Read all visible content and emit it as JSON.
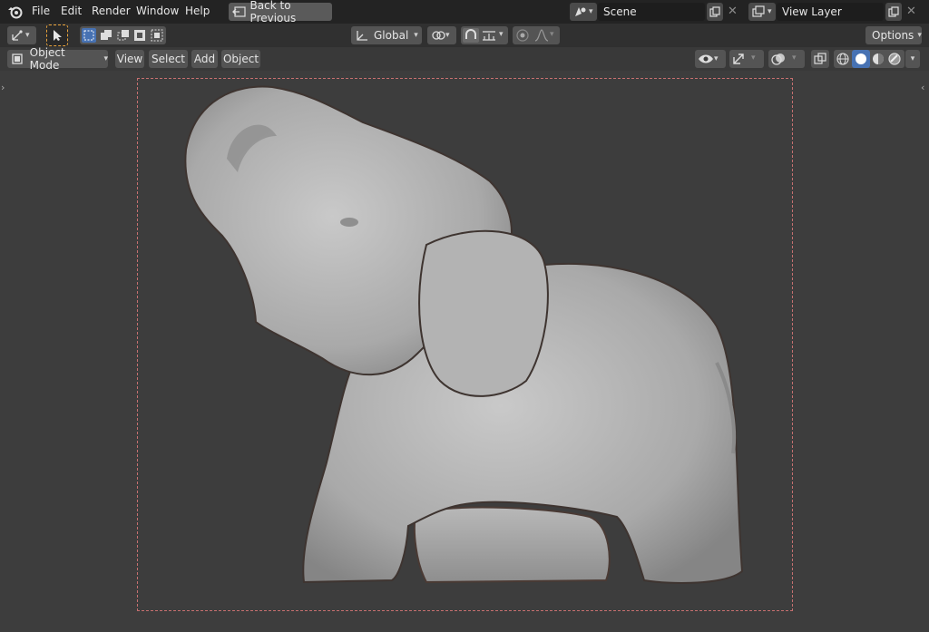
{
  "topbar": {
    "menus": [
      "File",
      "Edit",
      "Render",
      "Window",
      "Help"
    ],
    "back_button": "Back to Previous",
    "scene": {
      "label": "Scene"
    },
    "view_layer": {
      "label": "View Layer"
    }
  },
  "toolbar": {
    "orientation": "Global",
    "options_label": "Options"
  },
  "header": {
    "mode": "Object Mode",
    "menus": [
      "View",
      "Select",
      "Add",
      "Object"
    ]
  },
  "colors": {
    "accent_orange": "#e8a33c",
    "active_blue": "#4772b3",
    "camera_frame": "#c77070"
  },
  "icons": [
    "blender-logo-icon",
    "back-icon",
    "scene-icon",
    "view-layer-icon",
    "new-icon",
    "close-icon",
    "transform-pivot-icon",
    "select-cursor-icon",
    "snap-icon",
    "proportional-edit-icon",
    "visibility-icon",
    "gizmo-icon",
    "overlay-icon",
    "xray-icon",
    "wireframe-shading-icon",
    "solid-shading-icon",
    "material-shading-icon",
    "rendered-shading-icon"
  ]
}
